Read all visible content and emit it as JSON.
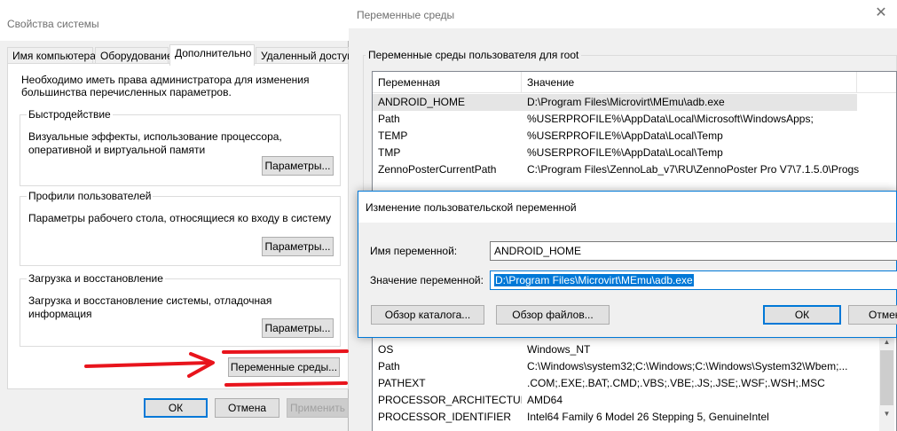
{
  "system_properties": {
    "window_title": "Свойства системы",
    "tabs": [
      "Имя компьютера",
      "Оборудование",
      "Дополнительно",
      "Удаленный доступ"
    ],
    "active_tab": "Дополнительно",
    "admin_note": "Необходимо иметь права администратора для изменения большинства перечисленных параметров.",
    "performance": {
      "title": "Быстродействие",
      "description": "Визуальные эффекты, использование процессора, оперативной и виртуальной памяти",
      "button": "Параметры..."
    },
    "user_profiles": {
      "title": "Профили пользователей",
      "description": "Параметры рабочего стола, относящиеся ко входу в систему",
      "button": "Параметры..."
    },
    "startup_recovery": {
      "title": "Загрузка и восстановление",
      "description": "Загрузка и восстановление системы, отладочная информация",
      "button": "Параметры..."
    },
    "env_vars_button": "Переменные среды...",
    "ok_button": "ОК",
    "cancel_button": "Отмена",
    "apply_button": "Применить"
  },
  "environment_variables": {
    "window_title": "Переменные среды",
    "user_section_title": "Переменные среды пользователя для root",
    "columns": [
      "Переменная",
      "Значение"
    ],
    "user_vars": [
      {
        "name": "ANDROID_HOME",
        "value": "D:\\Program Files\\Microvirt\\MEmu\\adb.exe"
      },
      {
        "name": "Path",
        "value": "%USERPROFILE%\\AppData\\Local\\Microsoft\\WindowsApps;"
      },
      {
        "name": "TEMP",
        "value": "%USERPROFILE%\\AppData\\Local\\Temp"
      },
      {
        "name": "TMP",
        "value": "%USERPROFILE%\\AppData\\Local\\Temp"
      },
      {
        "name": "ZennoPosterCurrentPath",
        "value": "C:\\Program Files\\ZennoLab_v7\\RU\\ZennoPoster Pro V7\\7.1.5.0\\Progs"
      }
    ],
    "system_vars": [
      {
        "name": "OS",
        "value": "Windows_NT"
      },
      {
        "name": "Path",
        "value": "C:\\Windows\\system32;C:\\Windows;C:\\Windows\\System32\\Wbem;..."
      },
      {
        "name": "PATHEXT",
        "value": ".COM;.EXE;.BAT;.CMD;.VBS;.VBE;.JS;.JSE;.WSF;.WSH;.MSC"
      },
      {
        "name": "PROCESSOR_ARCHITECTURE",
        "value": "AMD64"
      },
      {
        "name": "PROCESSOR_IDENTIFIER",
        "value": "Intel64 Family 6 Model 26 Stepping 5, GenuineIntel"
      }
    ]
  },
  "edit_dialog": {
    "title": "Изменение пользовательской переменной",
    "name_label": "Имя переменной:",
    "name_value": "ANDROID_HOME",
    "value_label": "Значение переменной:",
    "value_value": "D:\\Program Files\\Microvirt\\MEmu\\adb.exe",
    "browse_dir_button": "Обзор каталога...",
    "browse_file_button": "Обзор файлов...",
    "ok_button": "ОК",
    "cancel_button": "Отмен"
  },
  "icons": {
    "close": "close-icon",
    "scroll_up": "scroll-up-arrow-icon",
    "scroll_down": "scroll-down-arrow-icon",
    "annotation_arrow": "red-arrow-icon"
  },
  "colors": {
    "accent": "#0078d7",
    "annotation": "#e8141c",
    "selection_row": "#e5e5e5"
  }
}
